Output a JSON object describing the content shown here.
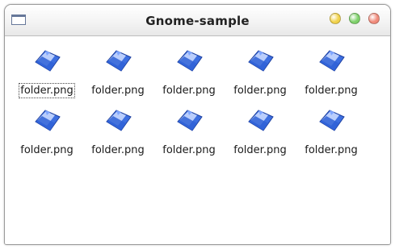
{
  "window": {
    "title": "Gnome-sample",
    "buttons": [
      {
        "name": "minimize",
        "color": "#f1d24a"
      },
      {
        "name": "maximize",
        "color": "#7ed16a"
      },
      {
        "name": "close",
        "color": "#f08a7a"
      }
    ]
  },
  "icon_view": {
    "items": [
      {
        "label": "folder.png",
        "icon": "folder-icon",
        "selected": true
      },
      {
        "label": "folder.png",
        "icon": "folder-icon",
        "selected": false
      },
      {
        "label": "folder.png",
        "icon": "folder-icon",
        "selected": false
      },
      {
        "label": "folder.png",
        "icon": "folder-icon",
        "selected": false
      },
      {
        "label": "folder.png",
        "icon": "folder-icon",
        "selected": false
      },
      {
        "label": "folder.png",
        "icon": "folder-icon",
        "selected": false
      },
      {
        "label": "folder.png",
        "icon": "folder-icon",
        "selected": false
      },
      {
        "label": "folder.png",
        "icon": "folder-icon",
        "selected": false
      },
      {
        "label": "folder.png",
        "icon": "folder-icon",
        "selected": false
      },
      {
        "label": "folder.png",
        "icon": "folder-icon",
        "selected": false
      }
    ]
  },
  "colors": {
    "folder_blue": "#3d6fe0",
    "folder_light": "#c8d8ff",
    "folder_dark": "#1d3f9f"
  }
}
